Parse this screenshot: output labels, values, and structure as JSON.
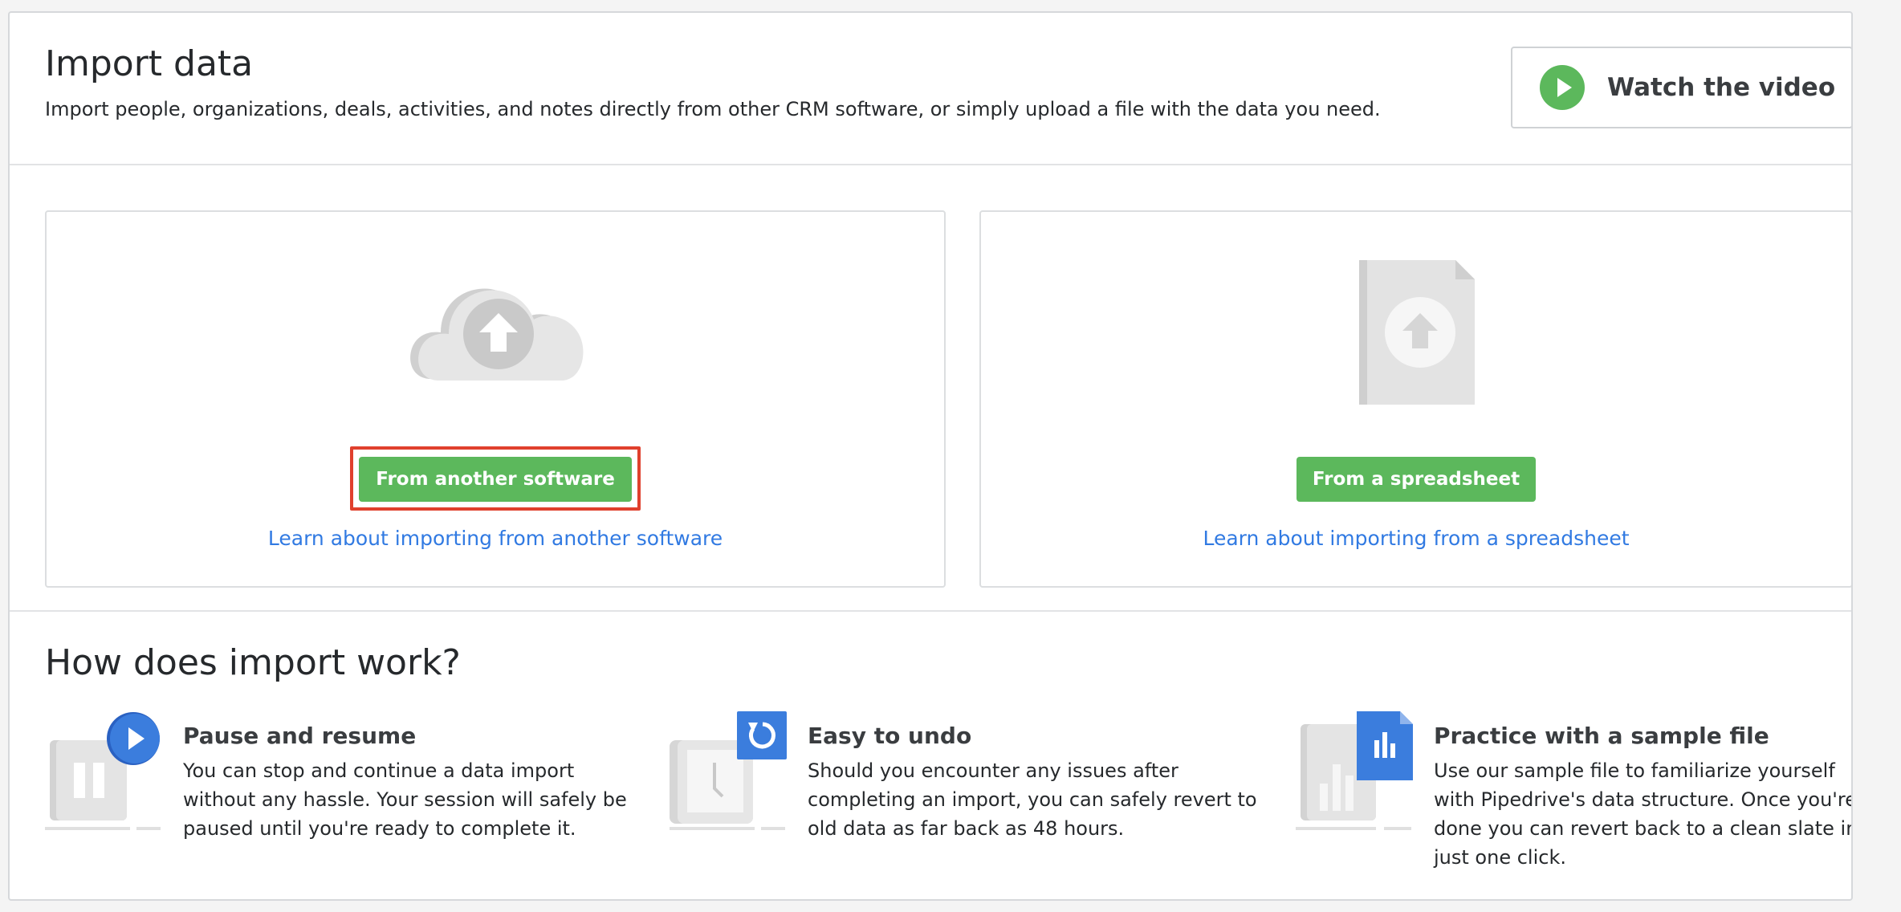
{
  "header": {
    "title": "Import data",
    "subtitle": "Import people, organizations, deals, activities, and notes directly from other CRM software, or simply upload a file with the data you need.",
    "video_button_label": "Watch the video"
  },
  "cards": {
    "software": {
      "icon": "cloud-upload-icon",
      "button_label": "From another software",
      "link_label": "Learn about importing from another software"
    },
    "spreadsheet": {
      "icon": "file-upload-icon",
      "button_label": "From a spreadsheet",
      "link_label": "Learn about importing from a spreadsheet"
    }
  },
  "how": {
    "title": "How does import work?",
    "features": [
      {
        "icon": "pause-play-icon",
        "title": "Pause and resume",
        "description": "You can stop and continue a data import without any hassle. Your session will safely be paused until you're ready to complete it."
      },
      {
        "icon": "clock-undo-icon",
        "title": "Easy to undo",
        "description": "Should you encounter any issues after completing an import, you can safely revert to old data as far back as 48 hours."
      },
      {
        "icon": "sample-file-chart-icon",
        "title": "Practice with a sample file",
        "description": "Use our sample file to familiarize yourself with Pipedrive's data structure. Once you're done you can revert back to a clean slate in just one click."
      }
    ]
  },
  "colors": {
    "primary_green": "#5cb85c",
    "link_blue": "#317ae2",
    "icon_blue": "#3b7ddd",
    "highlight_red": "#e0402d"
  }
}
